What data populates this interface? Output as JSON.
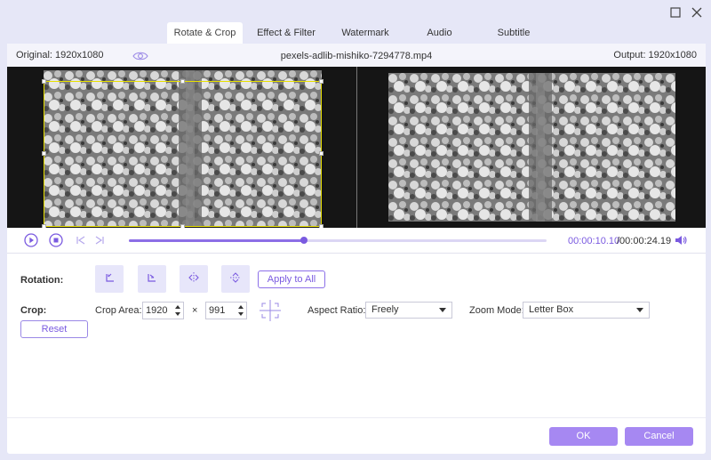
{
  "tabs": [
    {
      "label": "Rotate & Crop",
      "active": true
    },
    {
      "label": "Effect & Filter",
      "active": false
    },
    {
      "label": "Watermark",
      "active": false
    },
    {
      "label": "Audio",
      "active": false
    },
    {
      "label": "Subtitle",
      "active": false
    }
  ],
  "infobar": {
    "original": "Original: 1920x1080",
    "filename": "pexels-adlib-mishiko-7294778.mp4",
    "output": "Output: 1920x1080"
  },
  "playback": {
    "current_time": "00:00:10.10",
    "total_time": "/00:00:24.19",
    "progress_fraction": 0.42
  },
  "rotation": {
    "label": "Rotation:",
    "apply_all": "Apply to All"
  },
  "crop": {
    "label": "Crop:",
    "area_label": "Crop Area:",
    "width": "1920",
    "height": "991",
    "times": "×",
    "reset": "Reset",
    "aspect_label": "Aspect Ratio:",
    "aspect_value": "Freely",
    "zoom_label": "Zoom Mode:",
    "zoom_value": "Letter Box"
  },
  "footer": {
    "ok": "OK",
    "cancel": "Cancel"
  },
  "colors": {
    "accent": "#8c6ee6",
    "accent_soft": "#e7e6fa",
    "window_bg": "#e6e7f7",
    "crop_border": "#e8e000"
  }
}
